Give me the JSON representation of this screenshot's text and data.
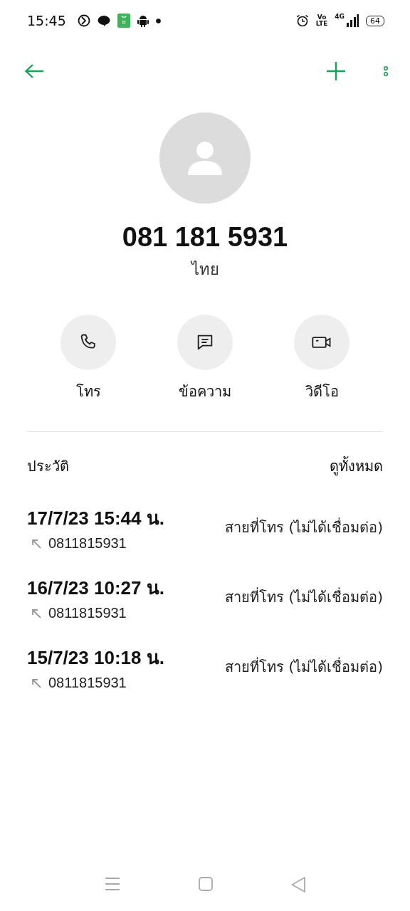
{
  "status_bar": {
    "time": "15:45",
    "volte_top": "Vo",
    "volte_bottom": "LTE",
    "network": "4G",
    "battery": "64"
  },
  "contact": {
    "number": "081 181 5931",
    "location": "ไทย"
  },
  "actions": [
    {
      "kind": "call",
      "label": "โทร"
    },
    {
      "kind": "message",
      "label": "ข้อความ"
    },
    {
      "kind": "video",
      "label": "วิดีโอ"
    }
  ],
  "history": {
    "title": "ประวัติ",
    "see_all": "ดูทั้งหมด",
    "entries": [
      {
        "datetime": "17/7/23 15:44 น.",
        "number": "0811815931",
        "type": "สายที่โทร (ไม่ได้เชื่อมต่อ)"
      },
      {
        "datetime": "16/7/23 10:27 น.",
        "number": "0811815931",
        "type": "สายที่โทร (ไม่ได้เชื่อมต่อ)"
      },
      {
        "datetime": "15/7/23 10:18 น.",
        "number": "0811815931",
        "type": "สายที่โทร (ไม่ได้เชื่อมต่อ)"
      }
    ]
  }
}
